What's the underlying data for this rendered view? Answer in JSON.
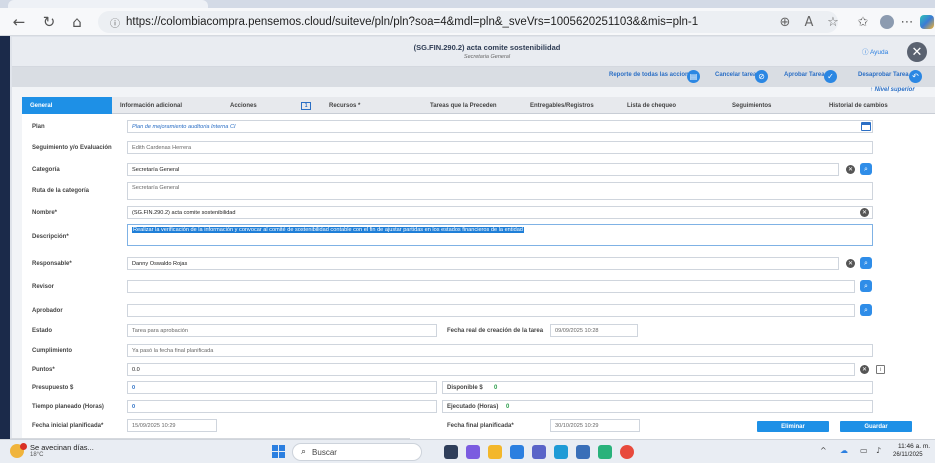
{
  "browser": {
    "url": "https://colombiacompra.pensemos.cloud/suiteve/pln/pln?soa=4&mdl=pln&_sveVrs=1005620251103&&mis=pln-1"
  },
  "modal": {
    "title": "(SG.FIN.290.2) acta comite sostenibilidad",
    "subtitle": "Secretaria General",
    "help": "Ayuda",
    "actions": {
      "reporte": "Reporte de todas las acciones",
      "cancelar": "Cancelar tarea",
      "aprobar": "Aprobar Tarea",
      "desaprobar": "Desaprobar Tarea"
    },
    "nivel_superior": "↑ Nivel superior"
  },
  "tabs": {
    "general": "General",
    "info": "Información adicional",
    "acciones": "Acciones",
    "acciones_count": "1",
    "recursos": "Recursos *",
    "tareas": "Tareas que la Preceden",
    "entregables": "Entregables/Registros",
    "lista": "Lista de chequeo",
    "seguimientos": "Seguimientos",
    "historial": "Historial de cambios"
  },
  "form": {
    "plan_label": "Plan",
    "plan_value": "Plan de mejoramiento auditoria Interna CI",
    "seguimiento_label": "Seguimiento y/o Evaluación",
    "seguimiento_value": "Edith Cardenas Herrera",
    "categoria_label": "Categoría",
    "categoria_value": "Secretaría General",
    "ruta_label": "Ruta de la categoría",
    "ruta_value": "Secretaría General",
    "nombre_label": "Nombre*",
    "nombre_value": "(SG.FIN.290.2) acta comite sostenibilidad",
    "descripcion_label": "Descripción*",
    "descripcion_value": "Realizar la verificación de la información y convocar al comité de sostenibilidad contable con el fin de ajustar partidas en los estados financieros de la entidad",
    "responsable_label": "Responsable*",
    "responsable_value": "Danny Oswaldo Rojas",
    "revisor_label": "Revisor",
    "aprobador_label": "Aprobador",
    "estado_label": "Estado",
    "estado_value": "Tarea para aprobación",
    "fecha_real_label": "Fecha real de creación de la tarea",
    "fecha_real_value": "09/09/2025 10:28",
    "cumplimiento_label": "Cumplimiento",
    "cumplimiento_value": "Ya pasó la fecha final planificada",
    "puntos_label": "Puntos*",
    "puntos_value": "0.0",
    "presupuesto_label": "Presupuesto $",
    "presupuesto_value": "0",
    "disponible_label": "Disponible $",
    "disponible_value": "0",
    "tiempo_label": "Tiempo planeado (Horas)",
    "tiempo_value": "0",
    "ejecutado_label": "Ejecutado (Horas)",
    "ejecutado_value": "0",
    "fecha_ini_label": "Fecha inicial planificada*",
    "fecha_ini_value": "15/09/2025 10:29",
    "fecha_fin_label": "Fecha final planificada*",
    "fecha_fin_value": "30/10/2025 10:29",
    "eliminar": "Eliminar",
    "guardar": "Guardar"
  },
  "taskbar": {
    "weather_title": "Se avecinan días...",
    "weather_temp": "18°C",
    "search": "Buscar",
    "time": "11:46 a. m.",
    "date": "26/11/2025"
  },
  "colors": {
    "accent": "#1e90e6",
    "link": "#2b6fc5",
    "sidebar": "#1b2a4a"
  }
}
